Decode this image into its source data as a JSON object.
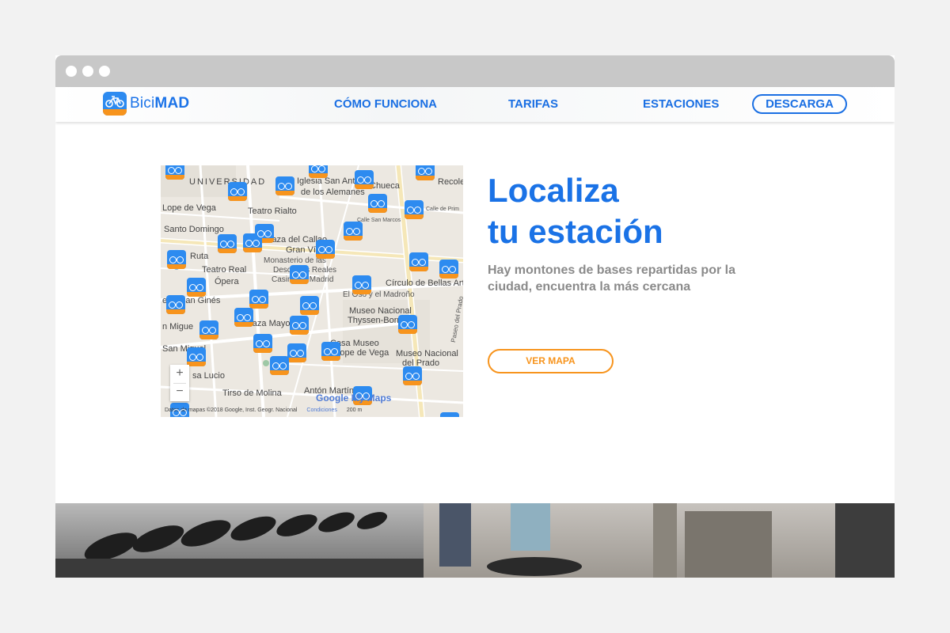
{
  "brand": {
    "name_light": "Bici",
    "name_bold": "MAD"
  },
  "nav": {
    "links": [
      "CÓMO FUNCIONA",
      "TARIFAS",
      "ESTACIONES"
    ],
    "cta": "DESCARGA"
  },
  "hero": {
    "title_line1": "Localiza",
    "title_line2": "tu estación",
    "description": "Hay montones de bases repartidas por la ciudad, encuentra la más cercana",
    "button": "VER MAPA"
  },
  "map": {
    "labels": [
      "UNIVERSIDAD",
      "Iglesia San Antón",
      "de los Alemanes",
      "Chueca",
      "Recole",
      "Lope de Vega",
      "Teatro Rialto",
      "Calle de Prim",
      "Calle San Marcos",
      "Santo Domingo",
      "laza del Callao",
      "Gran Vía",
      "Ruta",
      "Monasterio de las",
      "Descalzas Reales",
      "Teatro Real",
      "Casino de Madrid",
      "Círculo de Bellas Arte",
      "Ópera",
      "El Oso y el Madroño",
      "ería San Ginés",
      "Museo Nacional",
      "Thyssen-Bornem",
      "Paseo del Prado",
      "n Migue",
      "Plaza Mayor",
      "Casa Museo",
      "de Lope de Vega",
      "Museo Nacional",
      "del Prado",
      "San Miguel",
      "sa Lucio",
      "Tirso de Molina",
      "Antón Martín"
    ],
    "zoom_in": "+",
    "zoom_out": "−",
    "attribution": "Datos de mapas ©2018 Google, Inst. Geogr. Nacional",
    "terms": "Condiciones",
    "scale": "200 m",
    "watermark": "Google My Maps",
    "pin_icon": "bicycle-icon",
    "colors": {
      "pin_blue": "#2d8bf0",
      "pin_orange": "#f7941d"
    }
  },
  "colors": {
    "primary": "#1a72e6",
    "accent": "#f7941d",
    "text_muted": "#8a8a8a"
  }
}
